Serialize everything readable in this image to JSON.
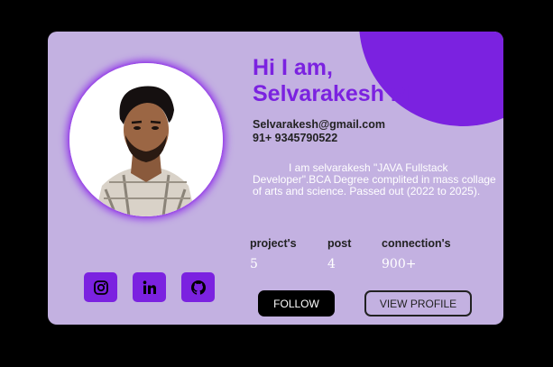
{
  "profile": {
    "greeting": "Hi I am,",
    "name": "Selvarakesh M",
    "email": "Selvarakesh@gmail.com",
    "phone": "91+ 9345790522",
    "bio": "I am selvarakesh \"JAVA Fullstack Developer\".BCA Degree complited in mass collage of arts and science. Passed out (2022 to 2025)."
  },
  "stats": [
    {
      "label": "project's",
      "value": "5"
    },
    {
      "label": "post",
      "value": "4"
    },
    {
      "label": "connection's",
      "value": "900+"
    }
  ],
  "actions": {
    "follow_label": "FOLLOW",
    "view_profile_label": "VIEW PROFILE"
  },
  "socials": [
    {
      "icon": "instagram-icon"
    },
    {
      "icon": "linkedin-icon"
    },
    {
      "icon": "github-icon"
    }
  ],
  "colors": {
    "page_background": "#000000",
    "card_background": "#c3b1e1",
    "accent": "#7b22e0",
    "follow_button": "#000000"
  }
}
